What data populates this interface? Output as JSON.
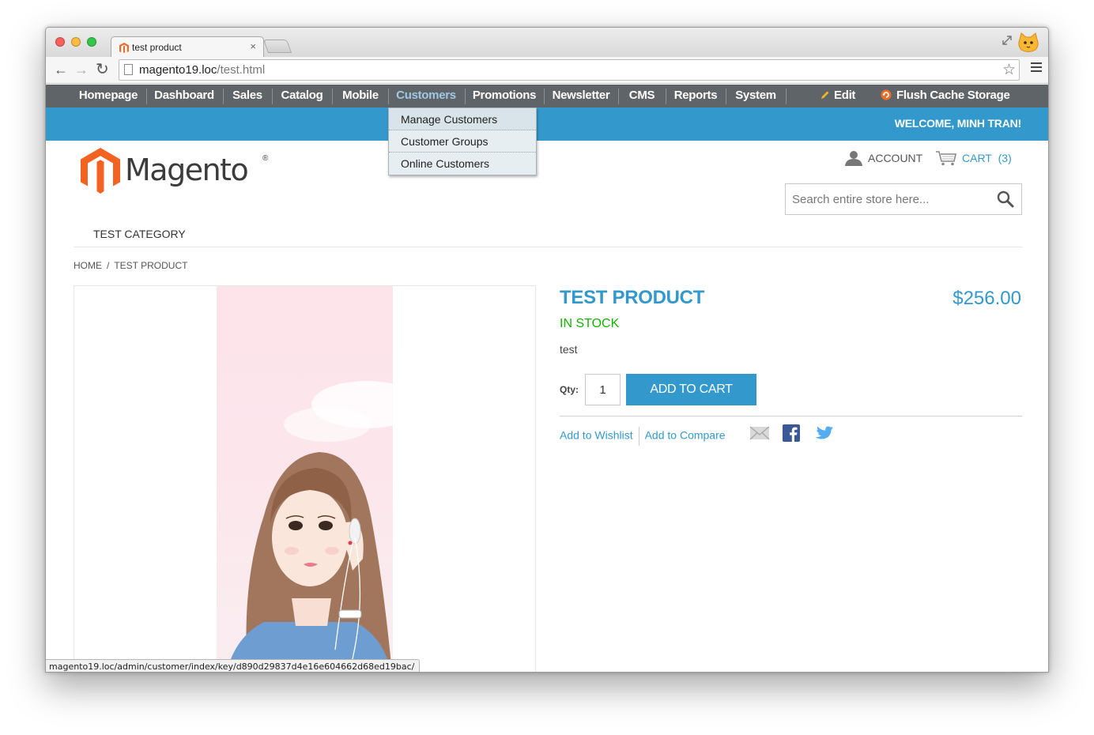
{
  "browser": {
    "tab_title": "test product",
    "tab_close": "×",
    "url_host": "magento19.loc",
    "url_path": "/test.html",
    "status_url": "magento19.loc/admin/customer/index/key/d890d29837d4e16e604662d68ed19bac/"
  },
  "admin_bar": {
    "items": [
      "Homepage",
      "Dashboard",
      "Sales",
      "Catalog",
      "Mobile",
      "Customers",
      "Promotions",
      "Newsletter",
      "CMS",
      "Reports",
      "System"
    ],
    "active": "Customers",
    "edit_label": "Edit",
    "flush_label": "Flush Cache Storage",
    "dropdown": [
      "Manage Customers",
      "Customer Groups",
      "Online Customers"
    ]
  },
  "header": {
    "welcome": "WELCOME, MINH TRAN!",
    "logo_text": "Magento",
    "logo_reg": "®",
    "account_label": "ACCOUNT",
    "cart_label": "CART",
    "cart_count": "(3)",
    "search_placeholder": "Search entire store here..."
  },
  "nav": {
    "category": "TEST CATEGORY"
  },
  "breadcrumb": {
    "home": "HOME",
    "separator": "/",
    "current": "TEST PRODUCT"
  },
  "product": {
    "name": "TEST PRODUCT",
    "price": "$256.00",
    "stock": "IN STOCK",
    "description": "test",
    "qty_label": "Qty:",
    "qty_value": "1",
    "add_to_cart": "ADD TO CART",
    "wishlist": "Add to Wishlist",
    "compare": "Add to Compare"
  },
  "colors": {
    "accent": "#3399cc",
    "admin_bar": "#5f6468",
    "in_stock": "#11b400"
  }
}
